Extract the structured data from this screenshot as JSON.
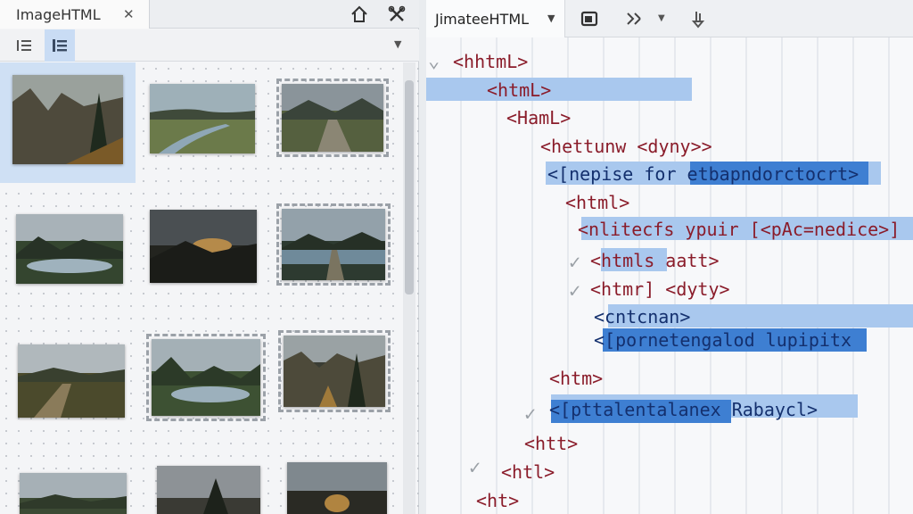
{
  "left_panel": {
    "tab": {
      "title": "ImageHTML",
      "close": "✕"
    },
    "view_options": {
      "dropdown": "▼"
    },
    "colors": {
      "selection": "#cfe0f4",
      "accent": "#c9dcf4"
    }
  },
  "editor": {
    "tab": {
      "title": "JimateeHTML",
      "dropdown": "▼"
    },
    "toolbar": {
      "dropdown_1": "▼"
    },
    "colors": {
      "tag": "#8a1c2a",
      "highlight": "#a9c8ee",
      "highlight_strong": "#3e7fd2"
    },
    "lines": [
      "<hhtmL>",
      "<htmL>",
      "<HamL>",
      "<hettunw <dyny>>",
      "<[nepise for etbapndorctocrt>",
      "<html>",
      "<nlitecfs ypuir [<pAc=nedice>]",
      "<htmls aatt>",
      "<htmr] <dyty>",
      "<cntcnan>",
      "<[pornetengalod lupipitx",
      "<htm>",
      "<[pttalentalanex Rabaycl>",
      "<htt>",
      "<htl>",
      "<ht>"
    ]
  }
}
